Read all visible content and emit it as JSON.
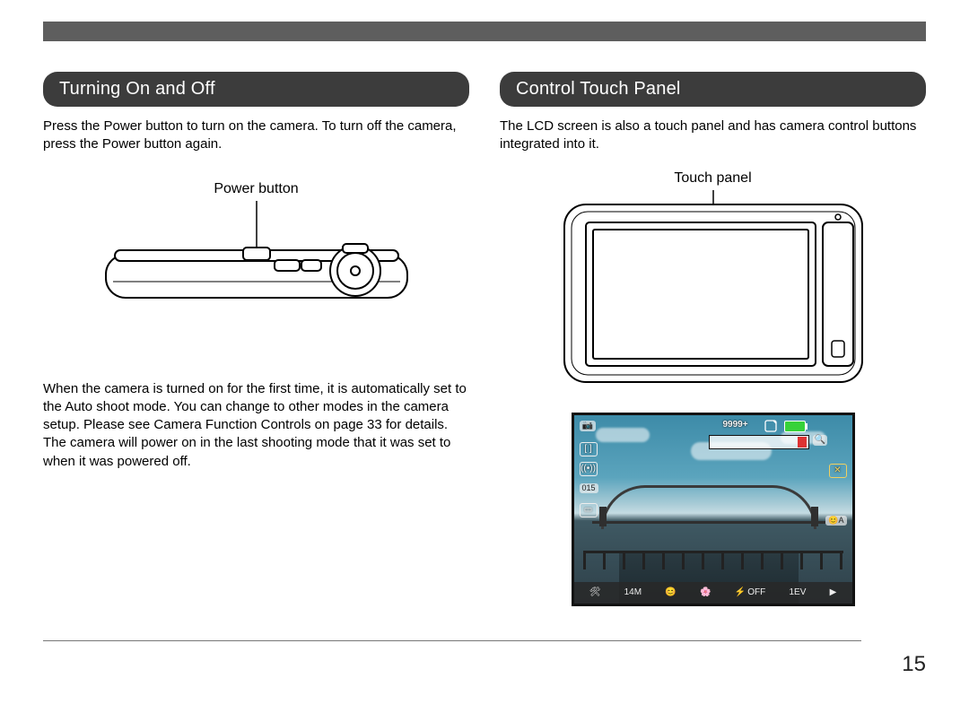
{
  "page_number": "15",
  "left": {
    "heading": "Turning On and Off",
    "intro": "Press the Power button to turn on the camera. To turn off the camera, press the Power button again.",
    "figure_label": "Power button",
    "note": "When the camera is turned on for the first time, it is automatically set to the Auto shoot mode. You can change to other modes in the camera setup. Please see Camera Function Controls on page 33 for details. The camera will power on in the last shooting mode that it was set to when it was powered off."
  },
  "right": {
    "heading": "Control Touch Panel",
    "intro": "The LCD screen is also a touch panel and has camera control buttons integrated into it.",
    "figure_label": "Touch panel"
  },
  "lcd_osd": {
    "shots_remaining": "9999+",
    "resolution": "14M",
    "iso_label": "015",
    "flash": "OFF",
    "ev": "1EV"
  }
}
